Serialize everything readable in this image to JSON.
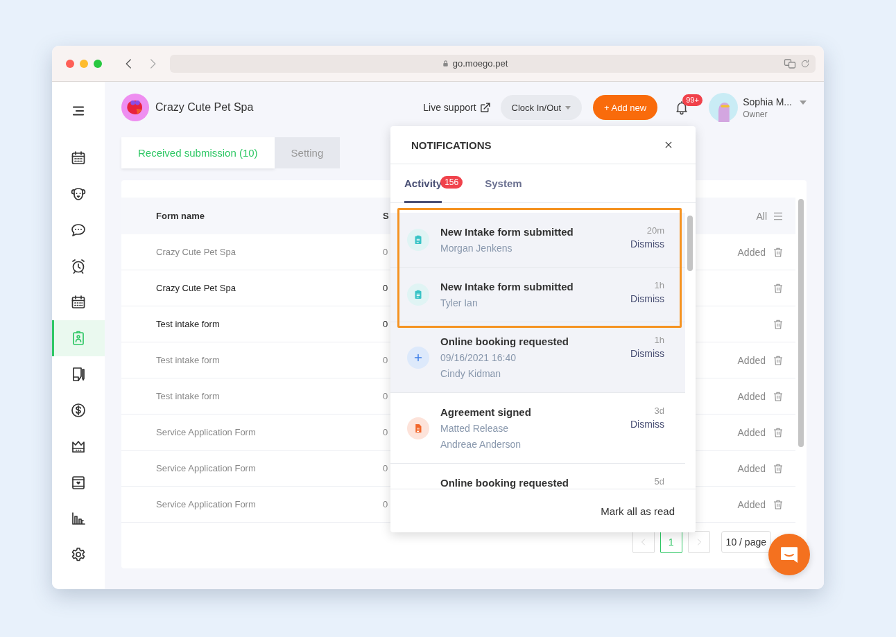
{
  "browser": {
    "url": "go.moego.pet"
  },
  "sidebar": {
    "items": [
      {
        "selected": false
      },
      {
        "selected": false
      },
      {
        "selected": false
      },
      {
        "selected": false
      },
      {
        "selected": false
      },
      {
        "selected": true
      },
      {
        "selected": false
      },
      {
        "selected": false
      },
      {
        "selected": false
      },
      {
        "selected": false
      },
      {
        "selected": false
      },
      {
        "selected": false
      }
    ]
  },
  "business": {
    "name": "Crazy Cute Pet Spa"
  },
  "header": {
    "live_support": "Live support",
    "clock_button": "Clock In/Out",
    "add_button": "+ Add new",
    "notification_count": "99+",
    "user": {
      "name": "Sophia M...",
      "role": "Owner"
    }
  },
  "tabs": [
    {
      "label": "Received submission (10)",
      "selected": true
    },
    {
      "label": "Setting",
      "selected": false
    }
  ],
  "table": {
    "columns": [
      "Form name",
      "S"
    ],
    "filter": "All",
    "rows": [
      {
        "name": "Crazy Cute Pet Spa",
        "column_2": "0",
        "unread": false,
        "status": "Added"
      },
      {
        "name": "Crazy Cute Pet Spa",
        "column_2": "0",
        "unread": true
      },
      {
        "name": "Test intake form",
        "column_2": "0",
        "unread": true
      },
      {
        "name": "Test intake form",
        "column_2": "0",
        "unread": false,
        "status": "Added"
      },
      {
        "name": "Test intake form",
        "column_2": "0",
        "unread": false,
        "status": "Added"
      },
      {
        "name": "Service Application Form",
        "column_2": "0",
        "unread": false,
        "status": "Added"
      },
      {
        "name": "Service Application Form",
        "column_2": "0",
        "unread": false,
        "status": "Added"
      },
      {
        "name": "Service Application Form",
        "column_2": "0",
        "unread": false,
        "status": "Added"
      }
    ]
  },
  "pagination": {
    "pages": [
      {
        "label": "1",
        "selected": true
      }
    ],
    "page_size": "10 / page"
  },
  "notifications": {
    "title": "NOTIFICATIONS",
    "tabs": [
      {
        "label": "Activity",
        "badge": "156",
        "selected": true
      },
      {
        "label": "System",
        "selected": false
      }
    ],
    "items": [
      {
        "kind": "intake",
        "title": "New Intake form submitted",
        "lines": [
          "Morgan Jenkens"
        ],
        "time": "20m",
        "action": "Dismiss",
        "unread": true,
        "highlighted": true
      },
      {
        "kind": "intake",
        "title": "New Intake form submitted",
        "lines": [
          "Tyler Ian"
        ],
        "time": "1h",
        "action": "Dismiss",
        "unread": true,
        "highlighted": true
      },
      {
        "kind": "booking",
        "title": "Online booking requested",
        "lines": [
          "09/16/2021 16:40",
          "Cindy Kidman"
        ],
        "time": "1h",
        "action": "Dismiss",
        "unread": true,
        "highlighted": false
      },
      {
        "kind": "agreement",
        "title": "Agreement signed",
        "lines": [
          "Matted Release",
          "Andreae Anderson"
        ],
        "time": "3d",
        "action": "Dismiss",
        "unread": false,
        "highlighted": false
      },
      {
        "title": "Online booking requested",
        "time": "5d",
        "unread": false,
        "highlighted": false
      }
    ],
    "footer": "Mark all as read"
  }
}
